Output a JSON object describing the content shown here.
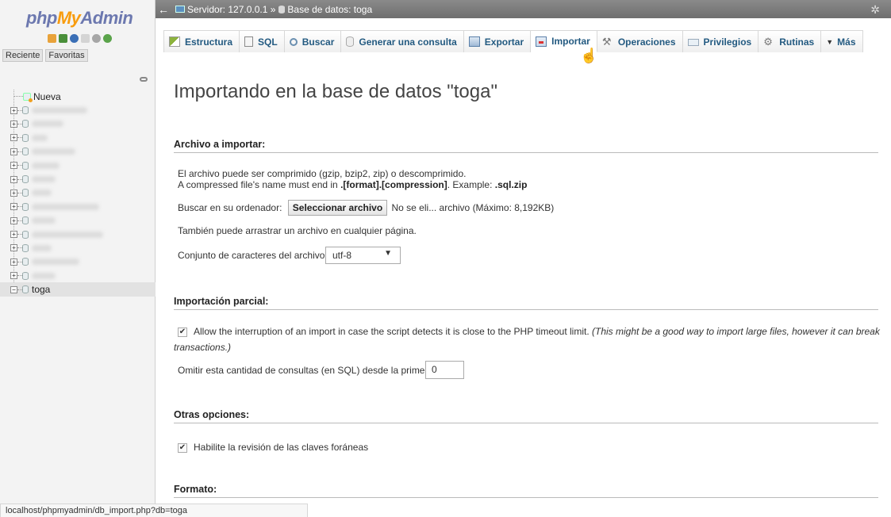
{
  "app": {
    "logo_php": "php",
    "logo_my": "My",
    "logo_admin": "Admin"
  },
  "nav": {
    "recent_label": "Reciente",
    "favorites_label": "Favoritas",
    "new_label": "Nueva",
    "active_db": "toga"
  },
  "topbar": {
    "server_crumb": "Servidor: 127.0.0.1 »",
    "db_crumb": "Base de datos: toga"
  },
  "tabs": [
    {
      "label": "Estructura",
      "icon": "structure-icon"
    },
    {
      "label": "SQL",
      "icon": "sql-icon"
    },
    {
      "label": "Buscar",
      "icon": "search-icon"
    },
    {
      "label": "Generar una consulta",
      "icon": "query-icon"
    },
    {
      "label": "Exportar",
      "icon": "export-icon"
    },
    {
      "label": "Importar",
      "icon": "import-icon",
      "active": true
    },
    {
      "label": "Operaciones",
      "icon": "wrench-icon"
    },
    {
      "label": "Privilegios",
      "icon": "privileges-icon"
    },
    {
      "label": "Rutinas",
      "icon": "routines-icon"
    },
    {
      "label": "Más",
      "icon": "triangle-down-icon"
    }
  ],
  "main": {
    "title": "Importando en la base de datos \"toga\"",
    "file_section": {
      "title": "Archivo a importar:",
      "desc1": "El archivo puede ser comprimido (gzip, bzip2, zip) o descomprimido.",
      "desc2_prefix": "A compressed file's name must end in ",
      "desc2_format": ".[format].[compression]",
      "desc2_example": ". Example: ",
      "desc2_ext": ".sql.zip",
      "browse_label": "Buscar en su ordenador:",
      "select_file_button": "Seleccionar archivo",
      "no_file_text": "No se eli... archivo",
      "max_size": "(Máximo: 8,192KB)",
      "drag_hint": "También puede arrastrar un archivo en cualquier página.",
      "charset_label": "Conjunto de caracteres del archivo:",
      "charset_value": "utf-8"
    },
    "partial_section": {
      "title": "Importación parcial:",
      "allow_interrupt_text": "Allow the interruption of an import in case the script detects it is close to the PHP timeout limit.",
      "allow_interrupt_note": "(This might be a good way to import large files, however it can break",
      "allow_interrupt_note2": "transactions.)",
      "allow_interrupt_checked": true,
      "skip_label": "Omitir esta cantidad de consultas (en SQL) desde la primera:",
      "skip_value": "0"
    },
    "other_section": {
      "title": "Otras opciones:",
      "fk_check_text": "Habilite la revisión de las claves foráneas",
      "fk_check_checked": true
    },
    "format_section": {
      "title": "Formato:"
    }
  },
  "status_url": "localhost/phpmyadmin/db_import.php?db=toga",
  "colors": {
    "tab_text": "#235a81",
    "logo_blue": "#6c78af",
    "logo_orange": "#f89c0e",
    "topbar": "#7a7a7a"
  }
}
